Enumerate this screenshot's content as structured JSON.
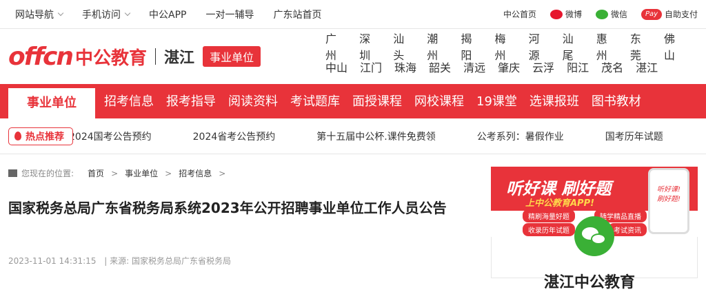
{
  "topbar": {
    "site_nav": "网站导航",
    "mobile": "手机访问",
    "app": "中公APP",
    "tutoring": "一对一辅导",
    "guangdong_home": "广东站首页",
    "home": "中公首页",
    "weibo": "微博",
    "wechat": "微信",
    "pay_badge": "Pay",
    "self_pay": "自助支付"
  },
  "header": {
    "logo_text": "offcn",
    "logo_cn": "中公教育",
    "city": "湛江",
    "tag": "事业单位",
    "cities_row1": [
      "广州",
      "深圳",
      "汕头",
      "潮州",
      "揭阳",
      "梅州",
      "河源",
      "汕尾",
      "惠州",
      "东莞",
      "佛山"
    ],
    "cities_row2": [
      "中山",
      "江门",
      "珠海",
      "韶关",
      "清远",
      "肇庆",
      "云浮",
      "阳江",
      "茂名",
      "湛江"
    ]
  },
  "nav": {
    "tabs": [
      "事业单位",
      "招考信息",
      "报考指导",
      "阅读资料",
      "考试题库",
      "面授课程",
      "网校课程",
      "19课堂",
      "选课报班",
      "图书教材"
    ]
  },
  "hot": {
    "badge": "热点推荐",
    "links": [
      "2024国考公告预约",
      "2024省考公告预约",
      "第十五届中公杯.课件免费领",
      "公考系列：暑假作业",
      "国考历年试题"
    ]
  },
  "breadcrumb": {
    "label": "您现在的位置:",
    "items": [
      "首页",
      "事业单位",
      "招考信息"
    ]
  },
  "article": {
    "title": "国家税务总局广东省税务局系统2023年公开招聘事业单位工作人员公告",
    "datetime": "2023-11-01 14:31:15",
    "source": "| 来源: 国家税务总局广东省税务局"
  },
  "promo": {
    "headline": "听好课 刷好题",
    "subline": "上中公教育APP!",
    "pill1": "精刷海量好题",
    "pill2": "随学精品直播",
    "pill3": "收录历年试题",
    "pill4": "考试资讯",
    "phone_text": "听好课! 刷好题!",
    "box_title": "湛江中公教育"
  },
  "colors": {
    "brand_red": "#e8333a",
    "wechat_green": "#3ab036"
  }
}
